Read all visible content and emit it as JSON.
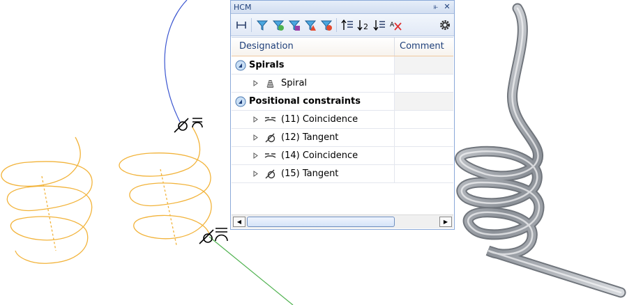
{
  "colors": {
    "spiral_curve": "#f2b33a",
    "blue_curve": "#3a55d0",
    "green_line": "#4fb24f",
    "panel_border": "#8aa8d8",
    "header_text": "#1e3f7a"
  },
  "panel": {
    "title": "HCM",
    "pin_icon": "pin-icon",
    "close_icon": "close-icon"
  },
  "toolbar": {
    "tools": [
      "dimension-tool-icon",
      "filter-blue-icon",
      "filter-green-icon",
      "filter-purple-icon",
      "filter-warning-icon",
      "filter-red-icon",
      "sort-up-icon",
      "sort-numbered-icon",
      "sort-down-icon",
      "delete-sort-icon"
    ],
    "settings_icon": "gear-icon"
  },
  "grid": {
    "columns": {
      "designation": "Designation",
      "comment": "Comment"
    },
    "rows": [
      {
        "type": "group",
        "label": "Spirals",
        "icon": "group-icon"
      },
      {
        "type": "item",
        "label": "Spiral",
        "icon": "spiral-icon"
      },
      {
        "type": "group",
        "label": "Positional constraints",
        "icon": "group-icon"
      },
      {
        "type": "item",
        "label": "(11) Coincidence",
        "icon": "coincidence-icon"
      },
      {
        "type": "item",
        "label": "(12) Tangent",
        "icon": "tangent-icon"
      },
      {
        "type": "item",
        "label": "(14) Coincidence",
        "icon": "coincidence-icon"
      },
      {
        "type": "item",
        "label": "(15) Tangent",
        "icon": "tangent-icon"
      }
    ]
  },
  "scrollbar": {
    "left_icon": "arrow-left-icon",
    "right_icon": "arrow-right-icon"
  }
}
